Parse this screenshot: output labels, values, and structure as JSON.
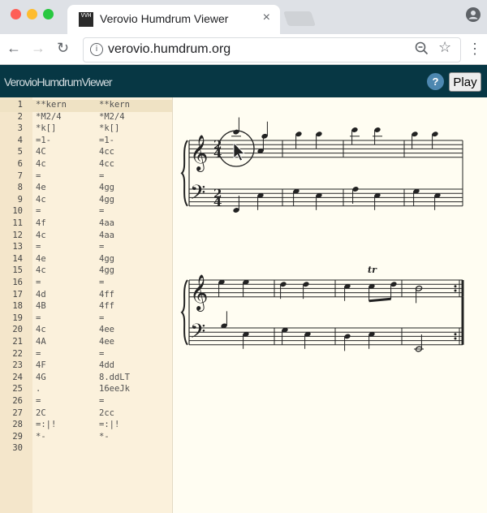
{
  "browser": {
    "tab_title": "Verovio Humdrum Viewer",
    "tab_favicon": "VVH",
    "close_glyph": "×",
    "url": "verovio.humdrum.org",
    "back_glyph": "←",
    "forward_glyph": "→",
    "reload_glyph": "↻",
    "info_glyph": "i",
    "star_glyph": "☆",
    "menu_glyph": "⋮"
  },
  "app": {
    "title": "VerovioHumdrumViewer",
    "help_label": "?",
    "play_label": "Play"
  },
  "editor": {
    "lines": [
      {
        "n": "1",
        "c1": "**kern",
        "c2": "**kern"
      },
      {
        "n": "2",
        "c1": "*M2/4",
        "c2": "*M2/4"
      },
      {
        "n": "3",
        "c1": "*k[]",
        "c2": "*k[]"
      },
      {
        "n": "4",
        "c1": "=1-",
        "c2": "=1-"
      },
      {
        "n": "5",
        "c1": "4C",
        "c2": "4cc"
      },
      {
        "n": "6",
        "c1": "4c",
        "c2": "4cc"
      },
      {
        "n": "7",
        "c1": "=",
        "c2": "="
      },
      {
        "n": "8",
        "c1": "4e",
        "c2": "4gg"
      },
      {
        "n": "9",
        "c1": "4c",
        "c2": "4gg"
      },
      {
        "n": "10",
        "c1": "=",
        "c2": "="
      },
      {
        "n": "11",
        "c1": "4f",
        "c2": "4aa"
      },
      {
        "n": "12",
        "c1": "4c",
        "c2": "4aa"
      },
      {
        "n": "13",
        "c1": "=",
        "c2": "="
      },
      {
        "n": "14",
        "c1": "4e",
        "c2": "4gg"
      },
      {
        "n": "15",
        "c1": "4c",
        "c2": "4gg"
      },
      {
        "n": "16",
        "c1": "=",
        "c2": "="
      },
      {
        "n": "17",
        "c1": "4d",
        "c2": "4ff"
      },
      {
        "n": "18",
        "c1": "4B",
        "c2": "4ff"
      },
      {
        "n": "19",
        "c1": "=",
        "c2": "="
      },
      {
        "n": "20",
        "c1": "4c",
        "c2": "4ee"
      },
      {
        "n": "21",
        "c1": "4A",
        "c2": "4ee"
      },
      {
        "n": "22",
        "c1": "=",
        "c2": "="
      },
      {
        "n": "23",
        "c1": "4F",
        "c2": "4dd"
      },
      {
        "n": "24",
        "c1": "4G",
        "c2": "8.ddLT"
      },
      {
        "n": "25",
        "c1": ".",
        "c2": "16eeJk"
      },
      {
        "n": "26",
        "c1": "=",
        "c2": "="
      },
      {
        "n": "27",
        "c1": "2C",
        "c2": "2cc"
      },
      {
        "n": "28",
        "c1": "=:|!",
        "c2": "=:|!"
      },
      {
        "n": "29",
        "c1": "*-",
        "c2": "*-"
      },
      {
        "n": "30",
        "c1": "",
        "c2": ""
      }
    ]
  },
  "notation": {
    "time_signature_top": "2",
    "time_signature_bottom": "4",
    "treble_clef": "𝄞",
    "bass_clef": "𝄢",
    "trill_mark": "tr"
  },
  "colors": {
    "header_bg": "#073744",
    "editor_bg": "#fbf1dc",
    "notation_bg": "#fffdf2"
  }
}
